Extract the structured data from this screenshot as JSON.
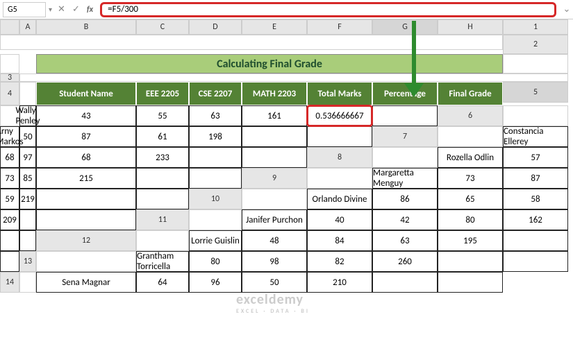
{
  "namebox": "G5",
  "formula": "=F5/300",
  "fx_label": "fx",
  "columns": [
    "A",
    "B",
    "C",
    "D",
    "E",
    "F",
    "G",
    "H"
  ],
  "row_numbers": [
    "1",
    "2",
    "3",
    "4",
    "5",
    "6",
    "7",
    "8",
    "9",
    "10",
    "11",
    "12",
    "13",
    "14"
  ],
  "title": "Calculating Final Grade",
  "headers": {
    "name": "Student Name",
    "c1": "EEE 2205",
    "c2": "CSE 2207",
    "c3": "MATH 2203",
    "total": "Total Marks",
    "pct": "Percentage",
    "grade": "Final Grade"
  },
  "rows": [
    {
      "name": "Wally Penley",
      "c1": "43",
      "c2": "55",
      "c3": "63",
      "total": "161",
      "pct": "0.536666667",
      "grade": ""
    },
    {
      "name": "Arny Markos",
      "c1": "50",
      "c2": "87",
      "c3": "61",
      "total": "198",
      "pct": "",
      "grade": ""
    },
    {
      "name": "Constancia Ellerey",
      "c1": "68",
      "c2": "97",
      "c3": "68",
      "total": "233",
      "pct": "",
      "grade": ""
    },
    {
      "name": "Rozella Odlin",
      "c1": "57",
      "c2": "73",
      "c3": "85",
      "total": "215",
      "pct": "",
      "grade": ""
    },
    {
      "name": "Margaretta Menguy",
      "c1": "73",
      "c2": "87",
      "c3": "59",
      "total": "219",
      "pct": "",
      "grade": ""
    },
    {
      "name": "Orlando Divine",
      "c1": "86",
      "c2": "65",
      "c3": "58",
      "total": "209",
      "pct": "",
      "grade": ""
    },
    {
      "name": "Janifer Purchon",
      "c1": "40",
      "c2": "42",
      "c3": "80",
      "total": "162",
      "pct": "",
      "grade": ""
    },
    {
      "name": "Lorrie Guislin",
      "c1": "48",
      "c2": "84",
      "c3": "63",
      "total": "195",
      "pct": "",
      "grade": ""
    },
    {
      "name": "Grantham Torricella",
      "c1": "80",
      "c2": "98",
      "c3": "82",
      "total": "260",
      "pct": "",
      "grade": ""
    },
    {
      "name": "Sena Magnar",
      "c1": "64",
      "c2": "96",
      "c3": "50",
      "total": "210",
      "pct": "",
      "grade": ""
    }
  ],
  "icons": {
    "cancel": "✕",
    "enter": "✓",
    "dropdown": "▾",
    "expand": "⌄"
  },
  "watermark": {
    "main": "exceldemy",
    "sub": "EXCEL · DATA · BI"
  },
  "chart_data": {
    "type": "table",
    "title": "Calculating Final Grade",
    "columns": [
      "Student Name",
      "EEE 2205",
      "CSE 2207",
      "MATH 2203",
      "Total Marks",
      "Percentage",
      "Final Grade"
    ],
    "data": [
      [
        "Wally Penley",
        43,
        55,
        63,
        161,
        0.536666667,
        null
      ],
      [
        "Arny Markos",
        50,
        87,
        61,
        198,
        null,
        null
      ],
      [
        "Constancia Ellerey",
        68,
        97,
        68,
        233,
        null,
        null
      ],
      [
        "Rozella Odlin",
        57,
        73,
        85,
        215,
        null,
        null
      ],
      [
        "Margaretta Menguy",
        73,
        87,
        59,
        219,
        null,
        null
      ],
      [
        "Orlando Divine",
        86,
        65,
        58,
        209,
        null,
        null
      ],
      [
        "Janifer Purchon",
        40,
        42,
        80,
        162,
        null,
        null
      ],
      [
        "Lorrie Guislin",
        48,
        84,
        63,
        195,
        null,
        null
      ],
      [
        "Grantham Torricella",
        80,
        98,
        82,
        260,
        null,
        null
      ],
      [
        "Sena Magnar",
        64,
        96,
        50,
        210,
        null,
        null
      ]
    ]
  }
}
